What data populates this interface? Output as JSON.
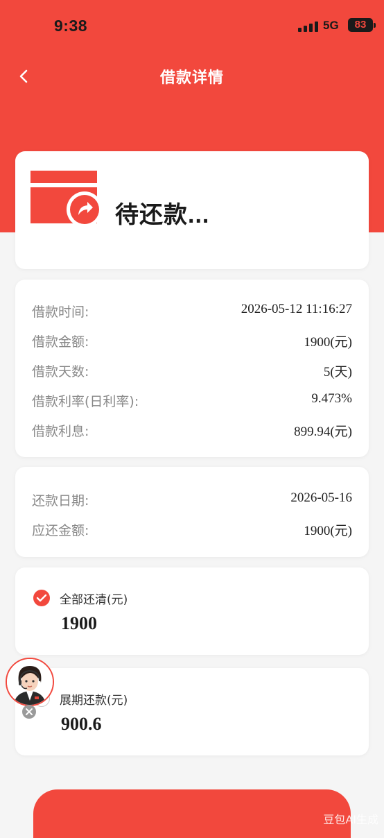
{
  "status_bar": {
    "time": "9:38",
    "network": "5G",
    "battery": "83"
  },
  "nav": {
    "title": "借款详情"
  },
  "status_card": {
    "text": "待还款..."
  },
  "loan_info": [
    {
      "label": "借款时间:",
      "value": "2026-05-12 11:16:27"
    },
    {
      "label": "借款金额:",
      "value": "1900(元)"
    },
    {
      "label": "借款天数:",
      "value": "5(天)"
    },
    {
      "label": "借款利率(日利率):",
      "value": "9.473%"
    },
    {
      "label": "借款利息:",
      "value": "899.94(元)"
    }
  ],
  "repay_info": [
    {
      "label": "还款日期:",
      "value": "2026-05-16"
    },
    {
      "label": "应还金额:",
      "value": "1900(元)"
    }
  ],
  "options": [
    {
      "label": "全部还清(元)",
      "amount": "1900",
      "selected": true
    },
    {
      "label": "展期还款(元)",
      "amount": "900.6",
      "selected": false
    }
  ],
  "watermark": "豆包AI生成",
  "colors": {
    "accent": "#f2483d",
    "background": "#f5f5f5"
  },
  "icons": [
    "back-arrow-icon",
    "repay-card-icon",
    "check-icon",
    "customer-service-avatar",
    "close-icon"
  ]
}
